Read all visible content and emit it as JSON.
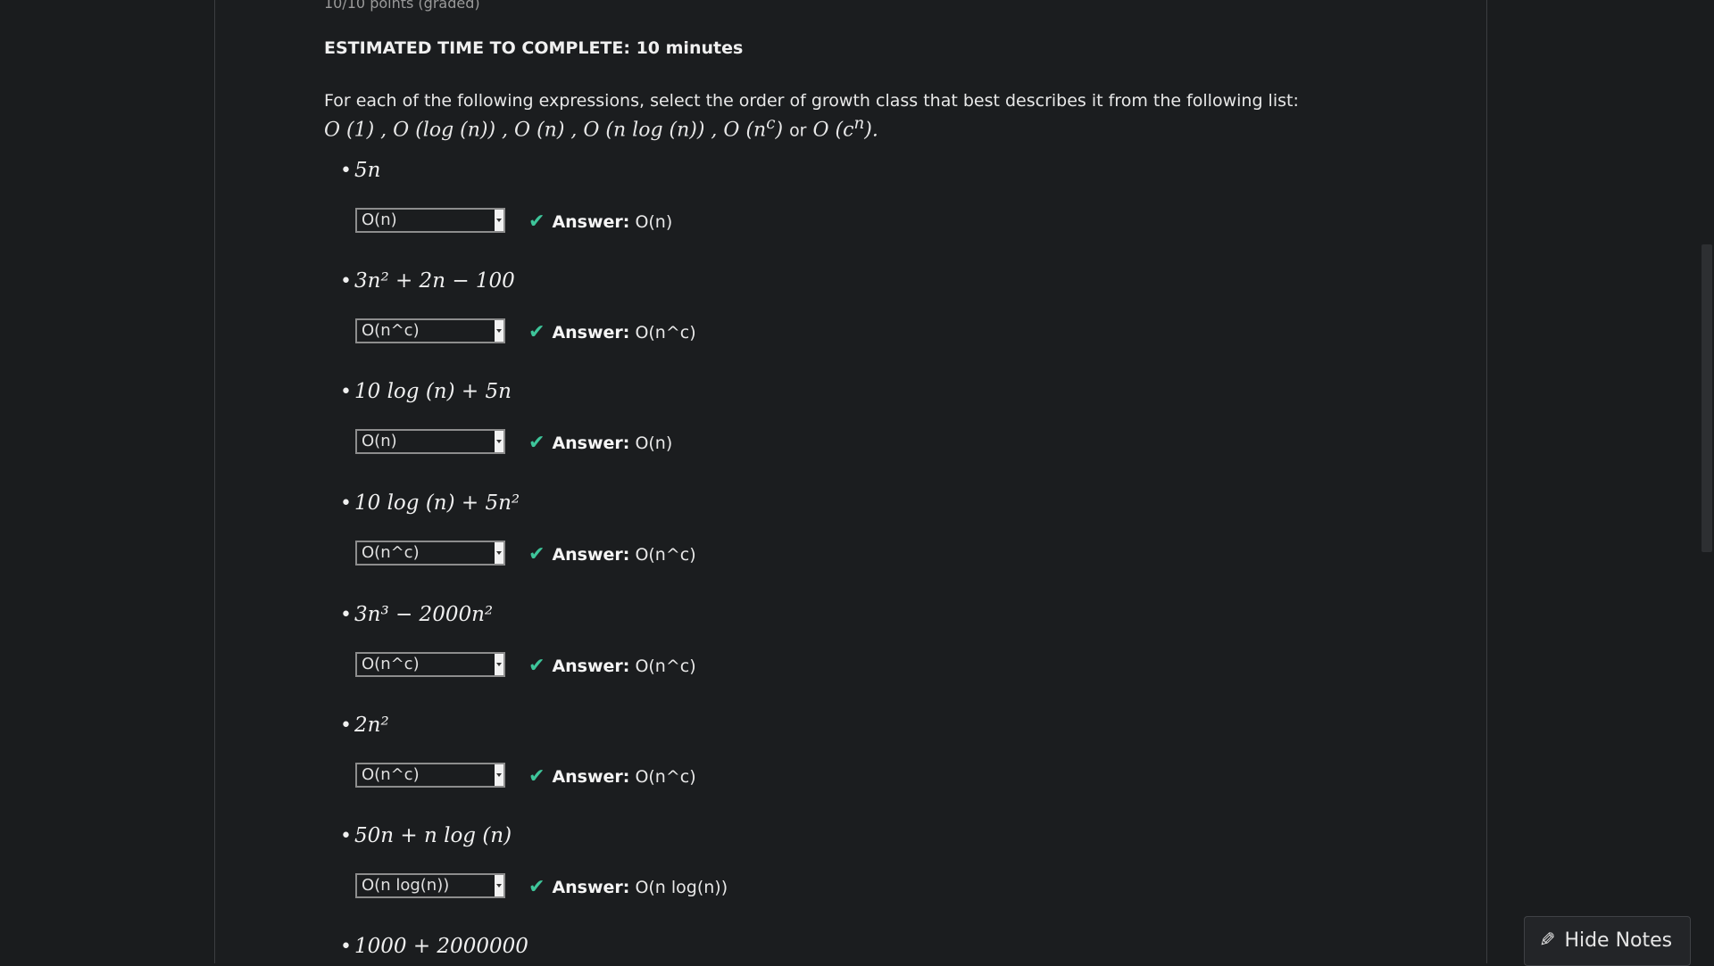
{
  "header": {
    "points": "10/10 points (graded)",
    "estimate": "ESTIMATED TIME TO COMPLETE: 10 minutes"
  },
  "intro": {
    "text": "For each of the following expressions, select the order of growth class that best describes it from the following list:",
    "classes_before_or": "O (1) , O (log (n)) , O (n) , O (n log (n)) , O (n",
    "or": "or",
    "classes_after_or": "O (c"
  },
  "items": [
    {
      "expression": "5n",
      "selected": "O(n)",
      "answer_label": "Answer:",
      "answer": "O(n)"
    },
    {
      "expression": "3n² + 2n − 100",
      "selected": "O(n^c)",
      "answer_label": "Answer:",
      "answer": "O(n^c)"
    },
    {
      "expression": "10 log (n) + 5n",
      "selected": "O(n)",
      "answer_label": "Answer:",
      "answer": "O(n)"
    },
    {
      "expression": "10 log (n) + 5n²",
      "selected": "O(n^c)",
      "answer_label": "Answer:",
      "answer": "O(n^c)"
    },
    {
      "expression": "3n³ − 2000n²",
      "selected": "O(n^c)",
      "answer_label": "Answer:",
      "answer": "O(n^c)"
    },
    {
      "expression": "2n²",
      "selected": "O(n^c)",
      "answer_label": "Answer:",
      "answer": "O(n^c)"
    },
    {
      "expression": "50n + n log (n)",
      "selected": "O(n log(n))",
      "answer_label": "Answer:",
      "answer": "O(n log(n))"
    },
    {
      "expression": "1000 + 2000000"
    }
  ],
  "notes_button": {
    "label": "Hide Notes",
    "icon": "pencil-icon"
  },
  "colors": {
    "background": "#1a1c1e",
    "check": "#3ec59a",
    "text": "#e3e3e3"
  }
}
